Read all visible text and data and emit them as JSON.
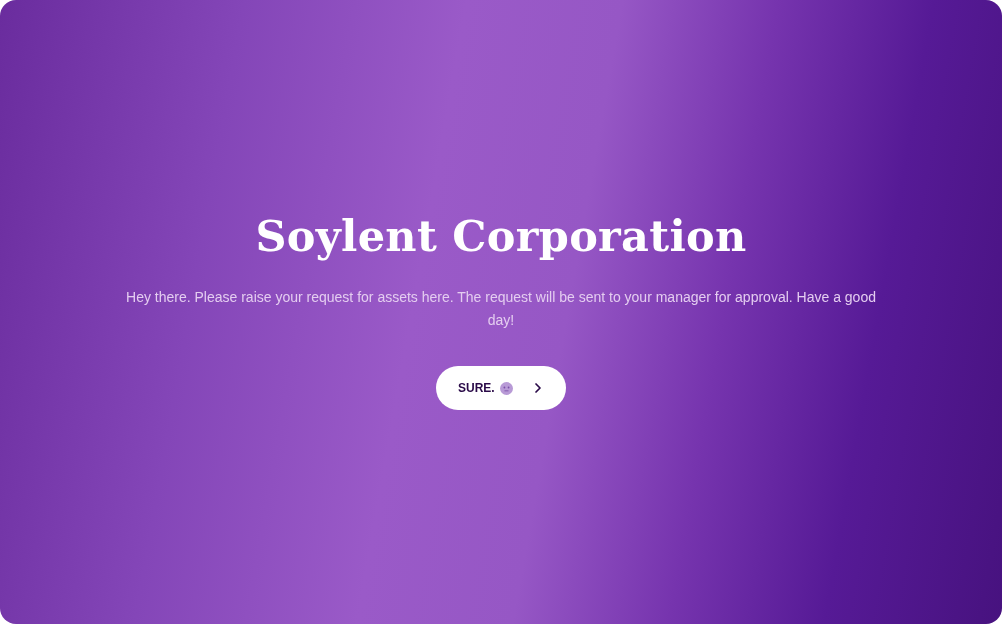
{
  "title": "Soylent Corporation",
  "message": "Hey there. Please raise your request for assets here. The request will be sent to your manager for approval. Have a good day!",
  "button": {
    "label": "SURE."
  }
}
